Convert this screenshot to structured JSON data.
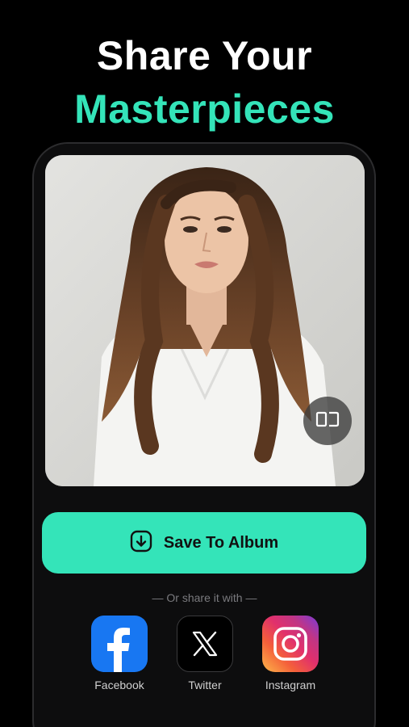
{
  "headline": {
    "line1": "Share Your",
    "line2": "Masterpieces"
  },
  "photo": {
    "subject": "portrait photo"
  },
  "compare_button": {
    "icon": "compare-icon"
  },
  "save_button": {
    "label": "Save To Album",
    "icon": "download-icon"
  },
  "share": {
    "caption": "— Or share it with —",
    "targets": [
      {
        "label": "Facebook",
        "icon": "facebook-icon"
      },
      {
        "label": "Twitter",
        "icon": "x-twitter-icon"
      },
      {
        "label": "Instagram",
        "icon": "instagram-icon"
      }
    ]
  },
  "colors": {
    "background": "#000000",
    "accent": "#34e4b9",
    "facebook": "#1877f2"
  }
}
